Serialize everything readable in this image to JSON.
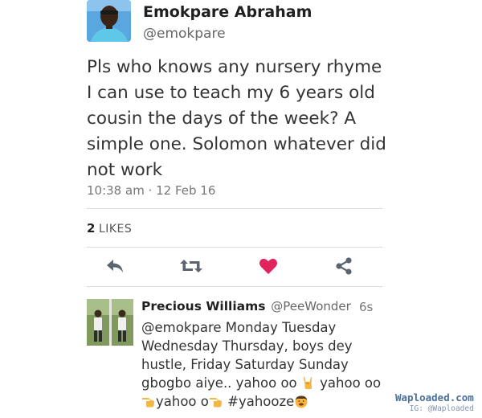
{
  "tweet": {
    "author": {
      "name": "Emokpare Abraham",
      "handle": "@emokpare"
    },
    "text": "Pls who knows any nursery rhyme I can use to teach my 6 years old cousin the days of the week? A simple one. Solomon whatever did not work",
    "timestamp": "10:38 am · 12 Feb 16",
    "likes": {
      "count": "2",
      "label": "LIKES"
    },
    "actions": {
      "reply_icon": "reply-icon",
      "retweet_icon": "retweet-icon",
      "like_icon": "heart-icon",
      "share_icon": "share-icon",
      "like_color": "#e0245e",
      "icon_color": "#5a6570"
    }
  },
  "reply": {
    "author": {
      "name": "Precious Williams",
      "handle": "@PeeWonder"
    },
    "time": "6s",
    "text_parts": [
      "@emokpare Monday Tuesday Wednesday Thursday, boys dey hustle, Friday Saturday Sunday gbogbo aiye..  yahoo oo ",
      " yahoo oo ",
      "yahoo o",
      " #yahooze"
    ]
  },
  "watermark": {
    "line1": "Waploaded.com",
    "line2": "IG: @Waploaded"
  }
}
